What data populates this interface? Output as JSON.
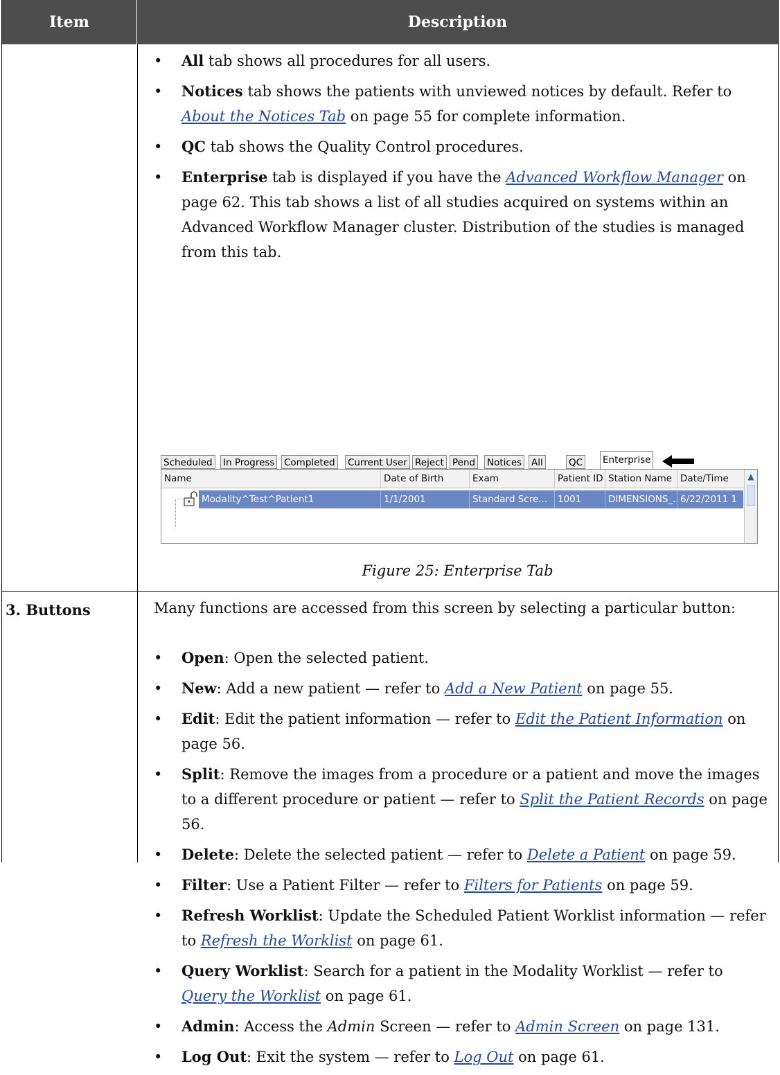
{
  "header": {
    "col1": "Item",
    "col2": "Description"
  },
  "tabs_section": {
    "bullets": [
      {
        "term": "All",
        "rest": " tab shows all procedures for all users."
      },
      {
        "term": "Notices",
        "rest_a": " tab shows the patients with unviewed notices by default. Refer to ",
        "link": "About the Notices Tab",
        "rest_b": " on page 55 for complete information."
      },
      {
        "term": "QC",
        "rest": " tab shows the Quality Control procedures."
      },
      {
        "term": "Enterprise",
        "rest_a": " tab is displayed if you have the ",
        "link": "Advanced Workflow Manager",
        "rest_b": " on page 62. This tab shows a list of all studies acquired on systems within an Advanced Workflow Manager cluster. Distribution of the studies is managed from this tab."
      }
    ]
  },
  "screenshot": {
    "tabs": [
      "Scheduled",
      "In Progress",
      "Completed",
      "Current User",
      "Reject",
      "Pend",
      "Notices",
      "All",
      "QC",
      "Enterprise"
    ],
    "active_tab": "Enterprise",
    "columns": [
      "Name",
      "Date of Birth",
      "Exam",
      "Patient ID",
      "Station Name",
      "Date/Time"
    ],
    "row": [
      "Modality^Test^Patient1",
      "1/1/2001",
      "Standard Scre...",
      "1001",
      "DIMENSIONS_...",
      "6/22/2011 1"
    ],
    "selection_color": "#6b86c4"
  },
  "figure_caption": "Figure 25: Enterprise Tab",
  "buttons_section": {
    "label": "3. Buttons",
    "intro": "Many functions are accessed from this screen by selecting a particular button:",
    "bullets": [
      {
        "term": "Open",
        "text_a": ": Open the selected patient.",
        "link": "",
        "text_b": ""
      },
      {
        "term": "New",
        "text_a": ": Add a new patient — refer to ",
        "link": "Add a New Patient",
        "text_b": " on page 55."
      },
      {
        "term": "Edit",
        "text_a": ": Edit the patient information — refer to ",
        "link": "Edit the Patient Information",
        "text_b": " on page 56."
      },
      {
        "term": "Split",
        "text_a": ": Remove the images from a procedure or a patient and move the images to a different procedure or patient — refer to ",
        "link": "Split the Patient Records",
        "text_b": " on page 56."
      },
      {
        "term": "Delete",
        "text_a": ": Delete the selected patient — refer to ",
        "link": "Delete a Patient",
        "text_b": " on page 59."
      },
      {
        "term": "Filter",
        "text_a": ": Use a Patient Filter — refer to ",
        "link": "Filters for Patients",
        "text_b": " on page 59."
      },
      {
        "term": "Refresh Worklist",
        "text_a": ": Update the Scheduled Patient Worklist information — refer to ",
        "link": "Refresh the Worklist",
        "text_b": " on page 61."
      },
      {
        "term": "Query Worklist",
        "text_a": ": Search for a patient in the Modality Worklist — refer to ",
        "link": "Query the Worklist",
        "text_b": " on page 61."
      },
      {
        "term": "Admin",
        "text_a": ": Access the ",
        "italic": "Admin",
        "text_a2": " Screen — refer to ",
        "link": "Admin Screen",
        "text_b": " on page 131."
      },
      {
        "term": "Log Out",
        "text_a": ": Exit the system — refer to ",
        "link": "Log Out",
        "text_b": " on page 61."
      }
    ]
  }
}
